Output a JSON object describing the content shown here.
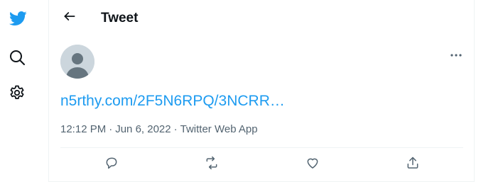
{
  "colors": {
    "brand": "#1d9bf0",
    "text_primary": "#0f1419",
    "text_secondary": "#536471",
    "border": "#eff3f4",
    "avatar_bg": "#ccd6dd"
  },
  "left_rail": {
    "icons": [
      "twitter-bird-icon",
      "search-icon",
      "settings-gear-icon"
    ]
  },
  "header": {
    "title": "Tweet",
    "back_icon": "arrow-left-icon"
  },
  "tweet": {
    "more_icon": "more-horizontal-icon",
    "link_text": "n5rthy.com/2F5N6RPQ/3NCRR…",
    "time": "12:12 PM",
    "date": "Jun 6, 2022",
    "source": "Twitter Web App",
    "separator": "·"
  },
  "actions": {
    "icons": [
      "reply-icon",
      "retweet-icon",
      "like-heart-icon",
      "share-icon"
    ]
  }
}
